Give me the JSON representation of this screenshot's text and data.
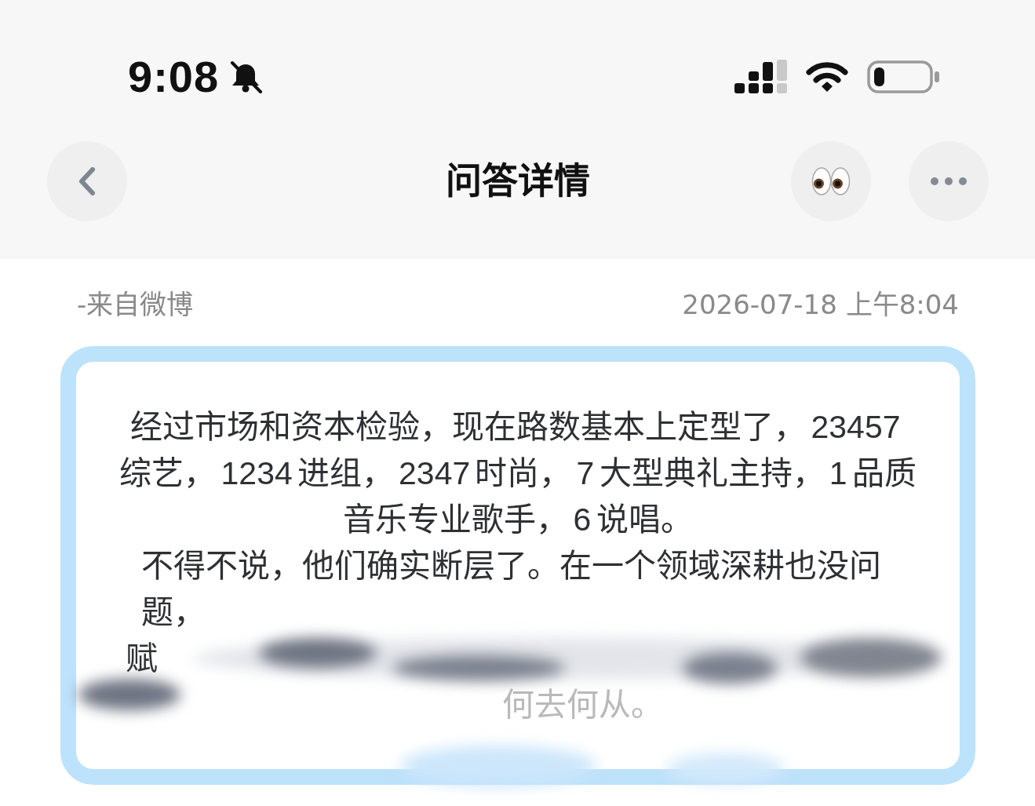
{
  "status_bar": {
    "time": "9:08",
    "silent": true
  },
  "nav": {
    "title": "问答详情"
  },
  "meta": {
    "source": "-来自微博",
    "datetime": "2026-07-18 上午8:04"
  },
  "card": {
    "paragraphs": [
      "经过市场和资本检验，现在路数基本上定型了，23457综艺，1234进组，2347时尚，7大型典礼主持，1品质音乐专业歌手，6说唱。",
      "不得不说，他们确实断层了。在一个领域深耕也没问题，"
    ],
    "fragments": [
      {
        "text": "赋",
        "faded": false
      },
      {
        "text": "何去何从。",
        "faded": true
      }
    ]
  }
}
